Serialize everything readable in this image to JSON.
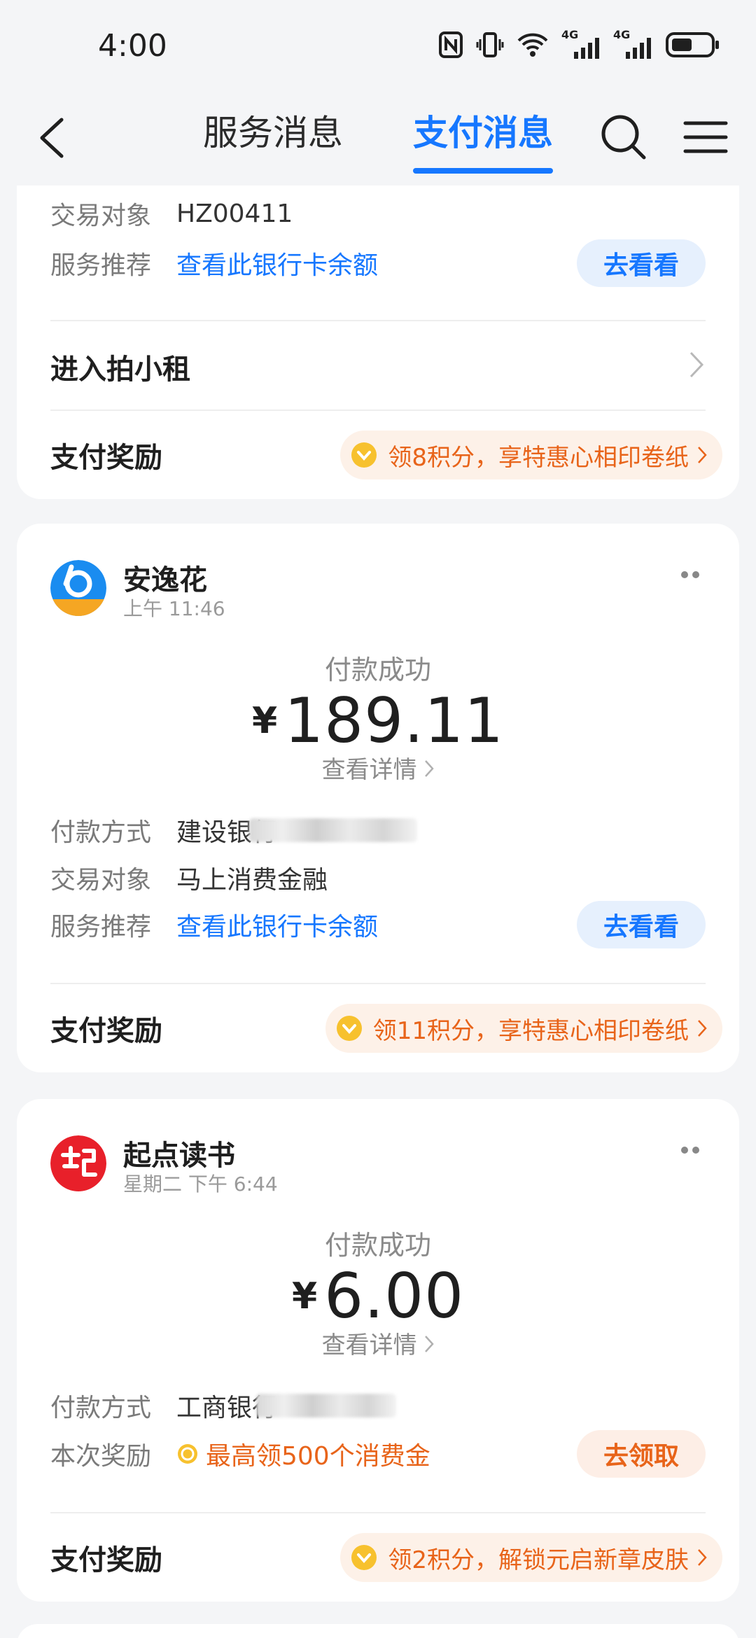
{
  "status_bar": {
    "time": "4:00",
    "network_1": "4G",
    "network_2": "4G"
  },
  "nav": {
    "tab_service": "服务消息",
    "tab_payment": "支付消息"
  },
  "card1": {
    "counterparty_label": "交易对象",
    "counterparty_value": "HZ00411",
    "service_label": "服务推荐",
    "service_link": "查看此银行卡余额",
    "service_button": "去看看",
    "enter_label": "进入拍小租",
    "reward_title": "支付奖励",
    "reward_text": "领8积分，享特惠心相印卷纸"
  },
  "card2": {
    "merchant_name": "安逸花",
    "merchant_time": "上午 11:46",
    "pay_status": "付款成功",
    "currency": "¥",
    "amount": "189.11",
    "detail_link": "查看详情",
    "method_label": "付款方式",
    "method_value": "建设银行",
    "counterparty_label": "交易对象",
    "counterparty_value": "马上消费金融",
    "service_label": "服务推荐",
    "service_link": "查看此银行卡余额",
    "service_button": "去看看",
    "reward_title": "支付奖励",
    "reward_text": "领11积分，享特惠心相印卷纸"
  },
  "card3": {
    "merchant_name": "起点读书",
    "merchant_time": "星期二 下午 6:44",
    "pay_status": "付款成功",
    "currency": "¥",
    "amount": "6.00",
    "detail_link": "查看详情",
    "method_label": "付款方式",
    "method_value": "工商银行",
    "bonus_label": "本次奖励",
    "bonus_text": "最高领500个消费金",
    "bonus_button": "去领取",
    "reward_title": "支付奖励",
    "reward_text": "领2积分，解锁元启新章皮肤"
  },
  "colors": {
    "accent_blue": "#1677ff",
    "accent_orange": "#e8641a",
    "background": "#f4f5f7"
  }
}
